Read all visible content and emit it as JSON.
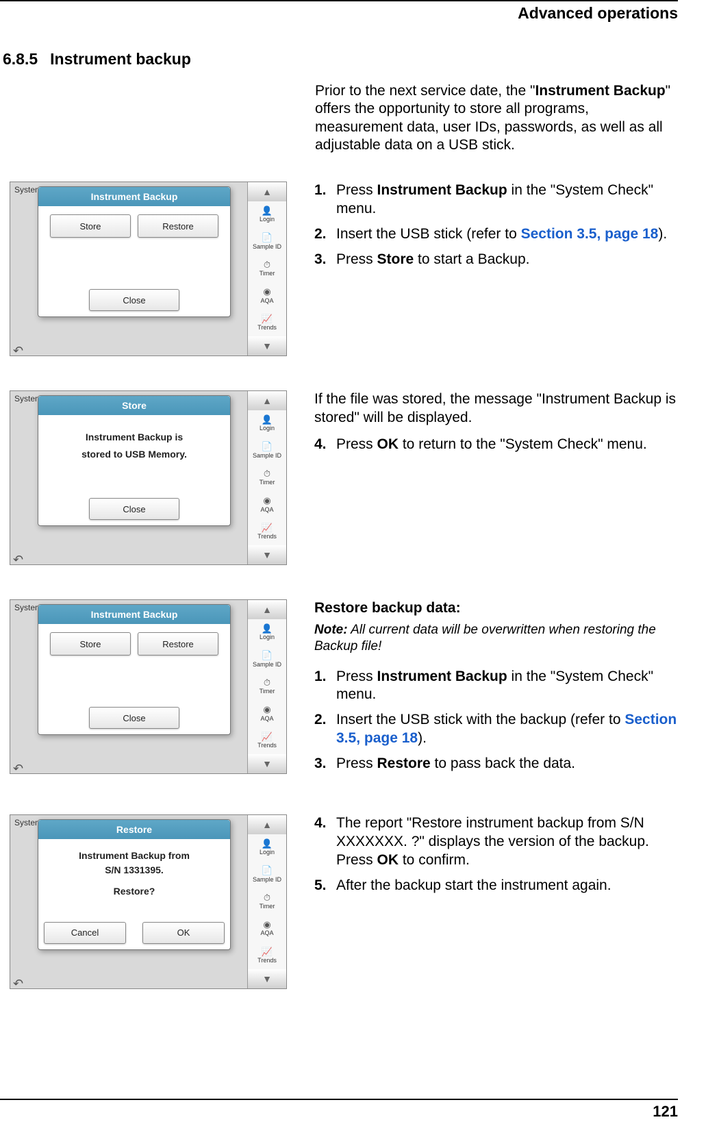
{
  "header": {
    "title": "Advanced operations"
  },
  "section": {
    "number": "6.8.5",
    "title": "Instrument backup"
  },
  "intro": {
    "pre": "Prior to the next service date, the \"",
    "bold": "Instrument Backup",
    "post": "\" offers the opportunity to store all programs, measurement data, user IDs, passwords, as well as all adjustable data on a USB stick."
  },
  "sidebar": {
    "up": "▲",
    "down": "▼",
    "items": [
      {
        "icon": "👤",
        "label": "Login"
      },
      {
        "icon": "📄",
        "label": "Sample ID"
      },
      {
        "icon": "⏱",
        "label": "Timer"
      },
      {
        "icon": "◉",
        "label": "AQA"
      },
      {
        "icon": "📈",
        "label": "Trends"
      }
    ]
  },
  "screenshots": {
    "backup": {
      "title": "Instrument Backup",
      "store": "Store",
      "restore": "Restore",
      "close": "Close",
      "sc": "System Checks"
    },
    "stored": {
      "title": "Store",
      "line1": "Instrument Backup is",
      "line2": "stored to USB Memory.",
      "close": "Close",
      "sc": "System Checks"
    },
    "restoreDlg": {
      "title": "Restore",
      "line1": "Instrument Backup from",
      "line2": "S/N 1331395.",
      "line3": "Restore?",
      "cancel": "Cancel",
      "ok": "OK",
      "sc": "System Checks"
    }
  },
  "block1": {
    "s1a": "Press ",
    "s1b": "Instrument Backup",
    "s1c": " in the \"System Check\" menu.",
    "s2a": "Insert the USB stick (refer to ",
    "s2link": "Section 3.5, page 18",
    "s2c": ").",
    "s3a": "Press ",
    "s3b": "Store",
    "s3c": " to start a Backup."
  },
  "block2": {
    "p": "If the file was stored, the message \"Instrument Backup is stored\" will be displayed.",
    "s4a": "Press ",
    "s4b": "OK",
    "s4c": " to return to the \"System Check\" menu."
  },
  "block3": {
    "heading": "Restore backup data:",
    "noteLabel": "Note:",
    "noteText": " All current data will be overwritten when restoring the Backup file!",
    "s1a": "Press ",
    "s1b": "Instrument Backup",
    "s1c": " in the \"System Check\" menu.",
    "s2a": "Insert the USB stick with the backup (refer to ",
    "s2link": "Section 3.5, page 18",
    "s2c": ").",
    "s3a": "Press ",
    "s3b": "Restore",
    "s3c": " to pass back the data."
  },
  "block4": {
    "s4a": "The report \"Restore instrument backup from S/N XXXXXXX. ?\" displays the version of the backup. Press ",
    "s4b": "OK",
    "s4c": " to confirm.",
    "s5": "After the backup start the instrument again."
  },
  "pageNumber": "121"
}
